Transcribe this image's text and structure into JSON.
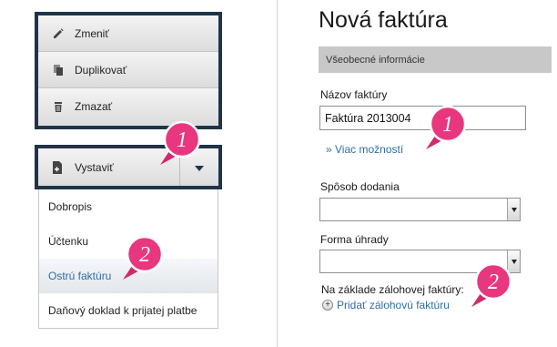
{
  "left_panel": {
    "actions": [
      {
        "label": "Zmeniť",
        "icon": "pencil-icon"
      },
      {
        "label": "Duplikovať",
        "icon": "duplicate-icon"
      },
      {
        "label": "Zmazať",
        "icon": "trash-icon"
      }
    ],
    "issue_button": {
      "label": "Vystaviť",
      "icon": "document-add-icon",
      "arrow_icon": "chevron-down-icon"
    },
    "issue_menu": [
      {
        "label": "Dobropis",
        "active": false
      },
      {
        "label": "Účtenku",
        "active": false
      },
      {
        "label": "Ostrú faktúru",
        "active": true
      },
      {
        "label": "Daňový doklad k prijatej platbe",
        "active": false
      }
    ]
  },
  "right_panel": {
    "title": "Nová faktúra",
    "section_header": "Všeobecné informácie",
    "invoice_name_label": "Názov faktúry",
    "invoice_name_value": "Faktúra 2013004",
    "more_options_link": "» Viac možností",
    "delivery_label": "Spôsob dodania",
    "delivery_value": "",
    "payment_label": "Forma úhrady",
    "payment_value": "",
    "proforma_label": "Na základe zálohovej faktúry:",
    "add_proforma_link": "Pridať zálohovú faktúru"
  },
  "callouts": [
    "1",
    "2",
    "1",
    "2"
  ],
  "colors": {
    "box_border": "#1f3447",
    "link": "#2e6da4",
    "callout_pink": "#e8377e",
    "section_bar": "#c8c8c8"
  }
}
